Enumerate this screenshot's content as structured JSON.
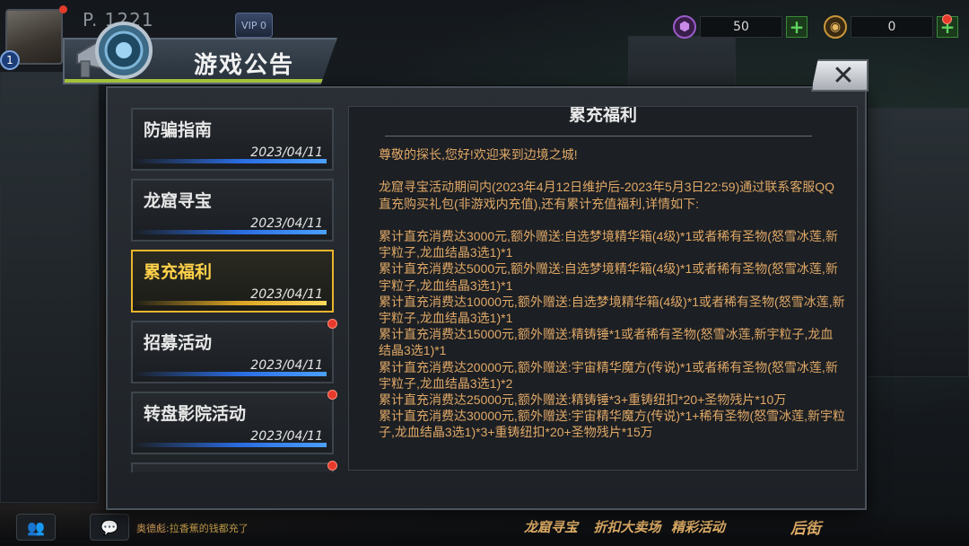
{
  "hud": {
    "player_id": "P.  1221",
    "vip": "VIP 0",
    "level": "1",
    "currency": [
      {
        "icon": "gem-icon",
        "amount": "50"
      },
      {
        "icon": "coin-icon",
        "amount": "0"
      }
    ]
  },
  "dialog": {
    "title": "游戏公告",
    "close_label": "✕"
  },
  "announcements": [
    {
      "name": "防骗指南",
      "date": "2023/04/11",
      "active": false,
      "unread": false
    },
    {
      "name": "龙窟寻宝",
      "date": "2023/04/11",
      "active": false,
      "unread": false
    },
    {
      "name": "累充福利",
      "date": "2023/04/11",
      "active": true,
      "unread": false
    },
    {
      "name": "招募活动",
      "date": "2023/04/11",
      "active": false,
      "unread": true
    },
    {
      "name": "转盘影院活动",
      "date": "2023/04/11",
      "active": false,
      "unread": true
    }
  ],
  "content": {
    "title": "累充福利",
    "greeting": "尊敬的探长,您好!欢迎来到边境之城!",
    "intro": "龙窟寻宝活动期间内(2023年4月12日维护后-2023年5月3日22:59)通过联系客服QQ直充购买礼包(非游戏内充值),还有累计充值福利,详情如下:",
    "rules": [
      "累计直充消费达3000元,额外赠送:自选梦境精华箱(4级)*1或者稀有圣物(怒雪冰莲,新宇粒子,龙血结晶3选1)*1",
      "累计直充消费达5000元,额外赠送:自选梦境精华箱(4级)*1或者稀有圣物(怒雪冰莲,新宇粒子,龙血结晶3选1)*1",
      "累计直充消费达10000元,额外赠送:自选梦境精华箱(4级)*1或者稀有圣物(怒雪冰莲,新宇粒子,龙血结晶3选1)*1",
      "累计直充消费达15000元,额外赠送:精铸锤*1或者稀有圣物(怒雪冰莲,新宇粒子,龙血结晶3选1)*1",
      "累计直充消费达20000元,额外赠送:宇宙精华魔方(传说)*1或者稀有圣物(怒雪冰莲,新宇粒子,龙血结晶3选1)*2",
      "累计直充消费达25000元,额外赠送:精铸锤*3+重铸纽扣*20+圣物残片*10万",
      "累计直充消费达30000元,额外赠送:宇宙精华魔方(传说)*1+稀有圣物(怒雪冰莲,新宇粒子,龙血结晶3选1)*3+重铸纽扣*20+圣物残片*15万"
    ]
  },
  "bottom": {
    "chat_speaker": "奥德彪",
    "chat_text": ":拉香蕉的钱都充了",
    "menu": [
      "龙窟寻宝",
      "折扣大卖场",
      "精彩活动",
      "后街"
    ]
  },
  "colors": {
    "accent_gold": "#e9b52a",
    "content_text": "#e0a867",
    "bar_blue": "#2a6be0",
    "unread_red": "#e73a2b"
  }
}
